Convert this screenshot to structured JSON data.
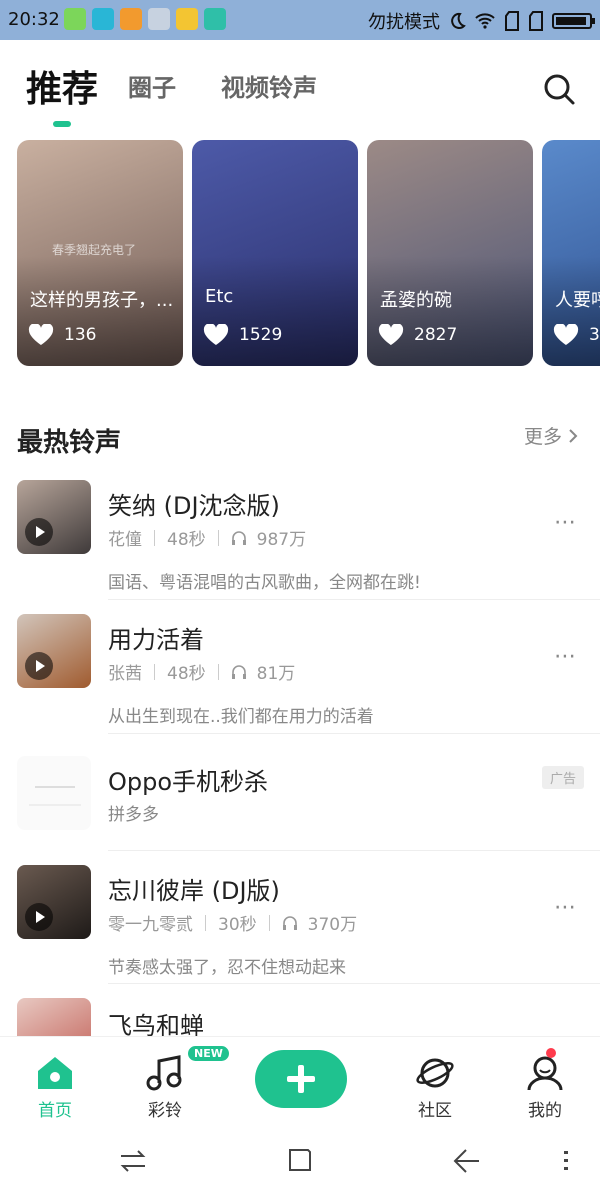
{
  "status": {
    "time": "20:32",
    "mode": "勿扰模式"
  },
  "tabs": [
    {
      "label": "推荐"
    },
    {
      "label": "圈子"
    },
    {
      "label": "视频铃声"
    }
  ],
  "banners": [
    {
      "title": "这样的男孩子，...",
      "likes": "136",
      "watermark": "春季翘起充电了",
      "color_a": "#c9b0a0",
      "color_b": "#6f5a54"
    },
    {
      "title": "Etc",
      "likes": "1529",
      "color_a": "#4d5aa8",
      "color_b": "#2a2f6b"
    },
    {
      "title": "孟婆的碗",
      "likes": "2827",
      "color_a": "#9c8a86",
      "color_b": "#4b5476"
    },
    {
      "title": "人要呼",
      "likes": "3",
      "color_a": "#5a8acb",
      "color_b": "#2b4b8a"
    }
  ],
  "section": {
    "title": "最热铃声",
    "more": "更多"
  },
  "songs": [
    {
      "title": "笑纳 (DJ沈念版)",
      "artist": "花僮",
      "duration": "48秒",
      "plays": "987万",
      "desc": "国语、粤语混唱的古风歌曲，全网都在跳!"
    },
    {
      "title": "用力活着",
      "artist": "张茜",
      "duration": "48秒",
      "plays": "81万",
      "desc": "从出生到现在..我们都在用力的活着"
    },
    {
      "title": "Oppo手机秒杀",
      "sub": "拼多多",
      "ad": "广告"
    },
    {
      "title": "忘川彼岸 (DJ版)",
      "artist": "零一九零贰",
      "duration": "30秒",
      "plays": "370万",
      "desc": "节奏感太强了，忍不住想动起来"
    },
    {
      "title": "飞鸟和蝉"
    }
  ],
  "bottom_nav": [
    {
      "label": "首页"
    },
    {
      "label": "彩铃",
      "badge": "NEW"
    },
    {
      "label": "社区"
    },
    {
      "label": "我的"
    }
  ],
  "colors": {
    "accent": "#1fc28f"
  }
}
